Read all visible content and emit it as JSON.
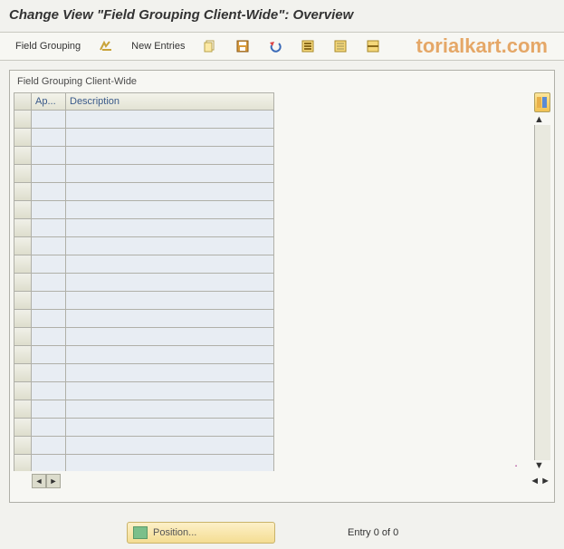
{
  "title": "Change View \"Field Grouping Client-Wide\": Overview",
  "watermark": "torialkart.com",
  "toolbar": {
    "field_grouping_label": "Field Grouping",
    "new_entries_label": "New Entries"
  },
  "panel": {
    "title": "Field Grouping Client-Wide",
    "columns": {
      "ap": "Ap...",
      "description": "Description"
    },
    "rows": [
      "",
      "",
      "",
      "",
      "",
      "",
      "",
      "",
      "",
      "",
      "",
      "",
      "",
      "",
      "",
      "",
      "",
      "",
      "",
      ""
    ]
  },
  "footer": {
    "position_label": "Position...",
    "entry_label": "Entry 0 of 0"
  }
}
